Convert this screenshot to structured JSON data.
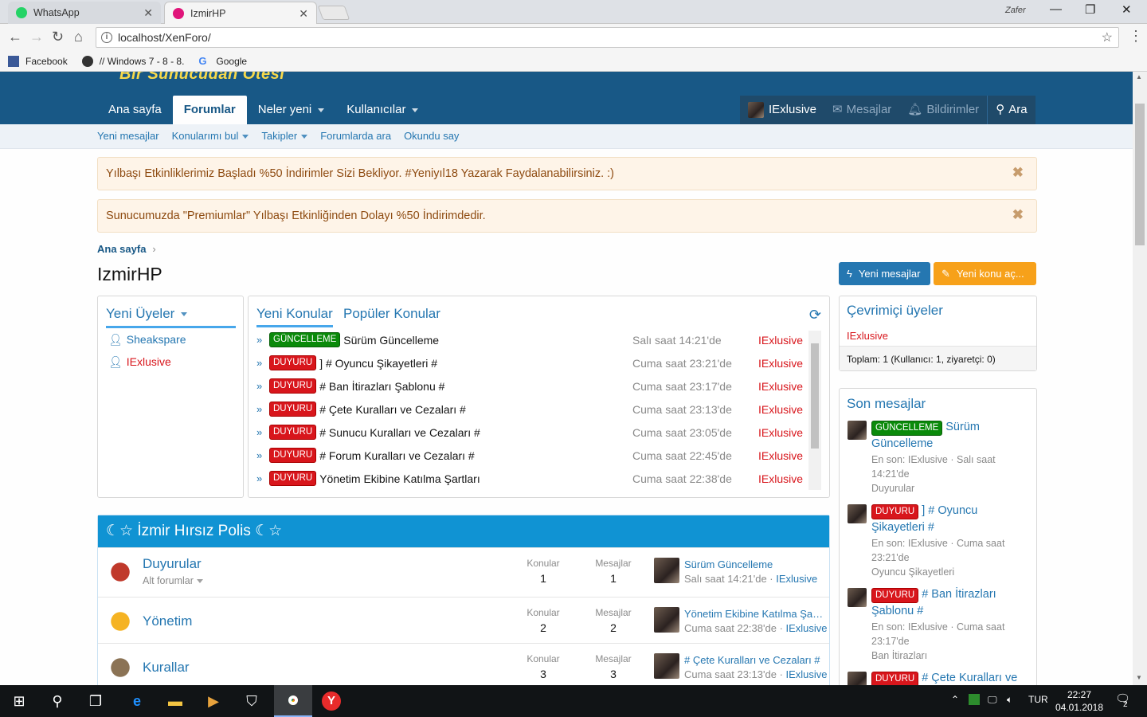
{
  "browser": {
    "tabs": [
      {
        "label": "WhatsApp",
        "active": false
      },
      {
        "label": "IzmirHP",
        "active": true
      }
    ],
    "profile_name": "Zafer",
    "url": "localhost/XenForo/",
    "bookmarks": [
      "Facebook",
      "// Windows 7 - 8 - 8.",
      "Google"
    ]
  },
  "site": {
    "logo_text": "Bir Sunucudan Ötesi",
    "nav": [
      "Ana sayfa",
      "Forumlar",
      "Neler yeni",
      "Kullanıcılar"
    ],
    "nav_user": "IExlusive",
    "nav_messages": "Mesajlar",
    "nav_alerts": "Bildirimler",
    "nav_search": "Ara",
    "subnav": [
      "Yeni mesajlar",
      "Konularımı bul",
      "Takipler",
      "Forumlarda ara",
      "Okundu say"
    ]
  },
  "notices": [
    "Yılbaşı Etkinliklerimiz Başladı %50 İndirimler Sizi Bekliyor. #Yeniyıl18 Yazarak Faydalanabilirsiniz. :)",
    "Sunucumuzda \"Premiumlar\" Yılbaşı Etkinliğinden Dolayı %50 İndirimdedir."
  ],
  "breadcrumb": "Ana sayfa",
  "page_title": "IzmirHP",
  "buttons": {
    "new_messages": "Yeni mesajlar",
    "new_topic": "Yeni konu aç..."
  },
  "new_users": {
    "title": "Yeni Üyeler",
    "users": [
      {
        "name": "Sheakspare",
        "color": "#2577b1"
      },
      {
        "name": "IExlusive",
        "color": "#d8161c"
      }
    ]
  },
  "topics": {
    "tab_new": "Yeni Konular",
    "tab_popular": "Popüler Konular",
    "rows": [
      {
        "label": "GÜNCELLEME",
        "label_color": "green",
        "title": "Sürüm Güncelleme",
        "date": "Salı saat 14:21'de",
        "user": "IExlusive"
      },
      {
        "label": "DUYURU",
        "label_color": "red",
        "title": "] # Oyuncu Şikayetleri #",
        "date": "Cuma saat 23:21'de",
        "user": "IExlusive"
      },
      {
        "label": "DUYURU",
        "label_color": "red",
        "title": "# Ban İtirazları Şablonu #",
        "date": "Cuma saat 23:17'de",
        "user": "IExlusive"
      },
      {
        "label": "DUYURU",
        "label_color": "red",
        "title": "# Çete Kuralları ve Cezaları #",
        "date": "Cuma saat 23:13'de",
        "user": "IExlusive"
      },
      {
        "label": "DUYURU",
        "label_color": "red",
        "title": "# Sunucu Kuralları ve Cezaları #",
        "date": "Cuma saat 23:05'de",
        "user": "IExlusive"
      },
      {
        "label": "DUYURU",
        "label_color": "red",
        "title": "# Forum Kuralları ve Cezaları #",
        "date": "Cuma saat 22:45'de",
        "user": "IExlusive"
      },
      {
        "label": "DUYURU",
        "label_color": "red",
        "title": "Yönetim Ekibine Katılma Şartları",
        "date": "Cuma saat 22:38'de",
        "user": "IExlusive"
      }
    ]
  },
  "online": {
    "title": "Çevrimiçi üyeler",
    "user": "IExlusive",
    "total": "Toplam: 1 (Kullanıcı: 1, ziyaretçi: 0)"
  },
  "recent": {
    "title": "Son mesajlar",
    "items": [
      {
        "label": "GÜNCELLEME",
        "label_color": "green",
        "title_a": "Sürüm",
        "title_b": "Güncelleme",
        "meta1": "En son: IExlusive · Salı saat",
        "meta2": "14:21'de",
        "forum": "Duyurular"
      },
      {
        "label": "DUYURU",
        "label_color": "red",
        "title_a": "] # Oyuncu",
        "title_b": "Şikayetleri #",
        "meta1": "En son: IExlusive · Cuma saat",
        "meta2": "23:21'de",
        "forum": "Oyuncu Şikayetleri"
      },
      {
        "label": "DUYURU",
        "label_color": "red",
        "title_a": "# Ban İtirazları",
        "title_b": "Şablonu #",
        "meta1": "En son: IExlusive · Cuma saat",
        "meta2": "23:17'de",
        "forum": "Ban İtirazları"
      },
      {
        "label": "DUYURU",
        "label_color": "red",
        "title_a": "# Çete Kuralları ve",
        "title_b": "",
        "meta1": "",
        "meta2": "",
        "forum": ""
      }
    ]
  },
  "category": {
    "title": "☾☆ İzmir Hırsız Polis ☾☆",
    "col_topics": "Konular",
    "col_messages": "Mesajlar",
    "forums": [
      {
        "name": "Duyurular",
        "sub": "Alt forumlar",
        "topics": "1",
        "messages": "1",
        "last_title": "Sürüm Güncelleme",
        "last_date": "Salı saat 14:21'de",
        "last_user": "IExlusive"
      },
      {
        "name": "Yönetim",
        "sub": "",
        "topics": "2",
        "messages": "2",
        "last_title": "Yönetim Ekibine Katılma Şar...",
        "last_date": "Cuma saat 22:38'de",
        "last_user": "IExlusive"
      },
      {
        "name": "Kurallar",
        "sub": "",
        "topics": "3",
        "messages": "3",
        "last_title": "# Çete Kuralları ve Cezaları #",
        "last_date": "Cuma saat 23:13'de",
        "last_user": "IExlusive"
      }
    ]
  },
  "taskbar": {
    "lang": "TUR",
    "time": "22:27",
    "date": "04.01.2018",
    "notif_count": "2"
  }
}
